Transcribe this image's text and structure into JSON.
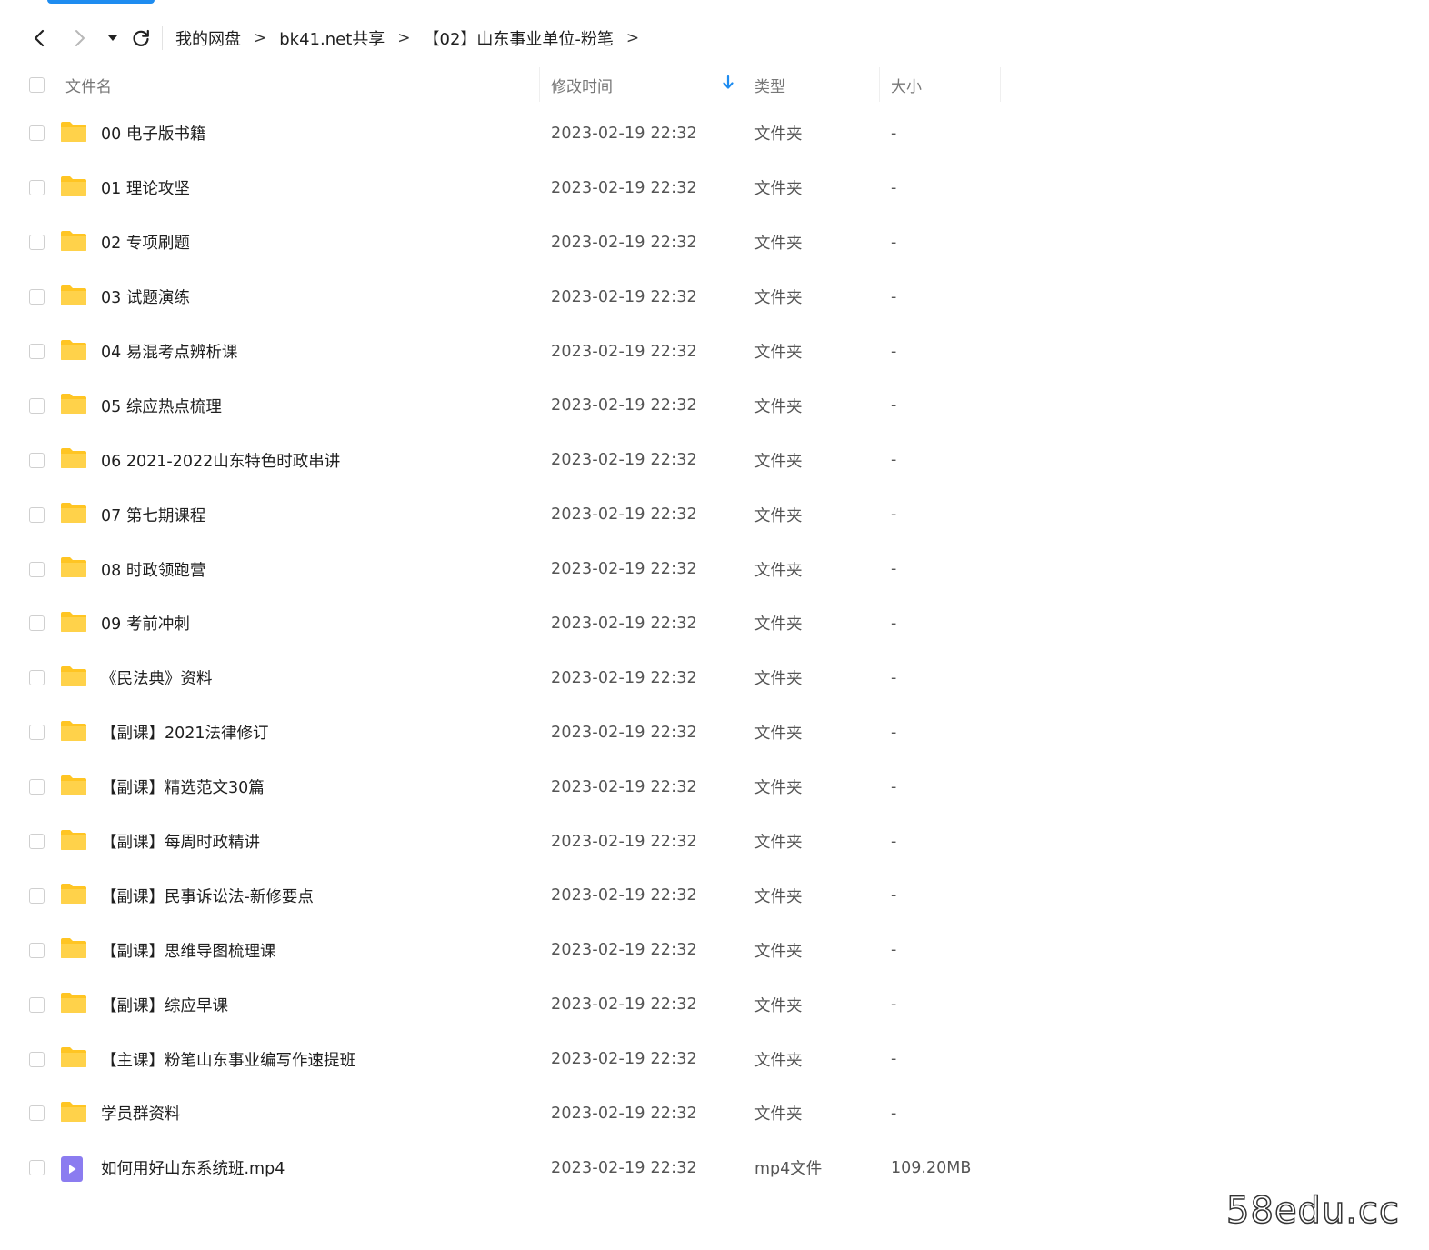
{
  "breadcrumb": {
    "items": [
      "我的网盘",
      "bk41.net共享",
      "【02】山东事业单位-粉笔"
    ],
    "separator": ">"
  },
  "columns": {
    "name": "文件名",
    "modified": "修改时间",
    "type": "类型",
    "size": "大小"
  },
  "files": [
    {
      "name": "00 电子版书籍",
      "modified": "2023-02-19 22:32",
      "type": "文件夹",
      "size": "-",
      "icon": "folder-icon"
    },
    {
      "name": "01 理论攻坚",
      "modified": "2023-02-19 22:32",
      "type": "文件夹",
      "size": "-",
      "icon": "folder-icon"
    },
    {
      "name": "02 专项刷题",
      "modified": "2023-02-19 22:32",
      "type": "文件夹",
      "size": "-",
      "icon": "folder-icon"
    },
    {
      "name": "03 试题演练",
      "modified": "2023-02-19 22:32",
      "type": "文件夹",
      "size": "-",
      "icon": "folder-icon"
    },
    {
      "name": "04 易混考点辨析课",
      "modified": "2023-02-19 22:32",
      "type": "文件夹",
      "size": "-",
      "icon": "folder-icon"
    },
    {
      "name": "05 综应热点梳理",
      "modified": "2023-02-19 22:32",
      "type": "文件夹",
      "size": "-",
      "icon": "folder-icon"
    },
    {
      "name": "06 2021-2022山东特色时政串讲",
      "modified": "2023-02-19 22:32",
      "type": "文件夹",
      "size": "-",
      "icon": "folder-icon"
    },
    {
      "name": "07 第七期课程",
      "modified": "2023-02-19 22:32",
      "type": "文件夹",
      "size": "-",
      "icon": "folder-icon"
    },
    {
      "name": "08 时政领跑营",
      "modified": "2023-02-19 22:32",
      "type": "文件夹",
      "size": "-",
      "icon": "folder-icon"
    },
    {
      "name": "09 考前冲刺",
      "modified": "2023-02-19 22:32",
      "type": "文件夹",
      "size": "-",
      "icon": "folder-icon"
    },
    {
      "name": "《民法典》资料",
      "modified": "2023-02-19 22:32",
      "type": "文件夹",
      "size": "-",
      "icon": "folder-icon"
    },
    {
      "name": "【副课】2021法律修订",
      "modified": "2023-02-19 22:32",
      "type": "文件夹",
      "size": "-",
      "icon": "folder-icon"
    },
    {
      "name": "【副课】精选范文30篇",
      "modified": "2023-02-19 22:32",
      "type": "文件夹",
      "size": "-",
      "icon": "folder-icon"
    },
    {
      "name": "【副课】每周时政精讲",
      "modified": "2023-02-19 22:32",
      "type": "文件夹",
      "size": "-",
      "icon": "folder-icon"
    },
    {
      "name": "【副课】民事诉讼法-新修要点",
      "modified": "2023-02-19 22:32",
      "type": "文件夹",
      "size": "-",
      "icon": "folder-icon"
    },
    {
      "name": "【副课】思维导图梳理课",
      "modified": "2023-02-19 22:32",
      "type": "文件夹",
      "size": "-",
      "icon": "folder-icon"
    },
    {
      "name": "【副课】综应早课",
      "modified": "2023-02-19 22:32",
      "type": "文件夹",
      "size": "-",
      "icon": "folder-icon"
    },
    {
      "name": "【主课】粉笔山东事业编写作速提班",
      "modified": "2023-02-19 22:32",
      "type": "文件夹",
      "size": "-",
      "icon": "folder-icon"
    },
    {
      "name": "学员群资料",
      "modified": "2023-02-19 22:32",
      "type": "文件夹",
      "size": "-",
      "icon": "folder-icon"
    },
    {
      "name": "如何用好山东系统班.mp4",
      "modified": "2023-02-19 22:32",
      "type": "mp4文件",
      "size": "109.20MB",
      "icon": "video-file-icon"
    }
  ],
  "watermark": "58edu.cc",
  "colors": {
    "accent": "#1e8cf0",
    "folder": "#ffc523",
    "video": "#8b7cf0"
  }
}
